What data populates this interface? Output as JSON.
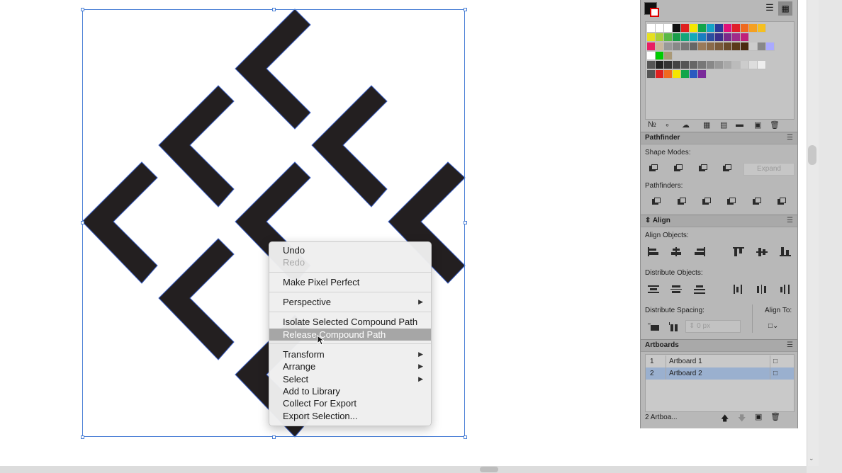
{
  "context_menu": {
    "items": [
      {
        "label": "Undo",
        "disabled": false
      },
      {
        "label": "Redo",
        "disabled": true
      },
      {
        "label": "Make Pixel Perfect",
        "disabled": false
      },
      {
        "label": "Perspective",
        "submenu": true
      },
      {
        "label": "Isolate Selected Compound Path",
        "disabled": false
      },
      {
        "label": "Release Compound Path",
        "highlighted": true
      },
      {
        "label": "Transform",
        "submenu": true
      },
      {
        "label": "Arrange",
        "submenu": true
      },
      {
        "label": "Select",
        "submenu": true
      },
      {
        "label": "Add to Library"
      },
      {
        "label": "Collect For Export"
      },
      {
        "label": "Export Selection..."
      }
    ]
  },
  "pathfinder": {
    "title": "Pathfinder",
    "shape_modes_label": "Shape Modes:",
    "expand_label": "Expand",
    "pathfinders_label": "Pathfinders:"
  },
  "align": {
    "title": "Align",
    "align_objects_label": "Align Objects:",
    "distribute_objects_label": "Distribute Objects:",
    "distribute_spacing_label": "Distribute Spacing:",
    "align_to_label": "Align To:",
    "spacing_value": "0 px"
  },
  "artboards": {
    "title": "Artboards",
    "rows": [
      {
        "num": "1",
        "name": "Artboard 1",
        "selected": false
      },
      {
        "num": "2",
        "name": "Artboard 2",
        "selected": true
      }
    ],
    "count_label": "2 Artboa..."
  },
  "colors": {
    "selection": "#4a7fd6",
    "artwork_fill": "#231f20",
    "menu_highlight": "#a6a6a6",
    "artboard_selected_row": "#9ab0cf",
    "panel_bg": "#b8b8b8"
  },
  "icons": {
    "list_view": "list-view-icon",
    "grid_view": "grid-view-icon"
  }
}
